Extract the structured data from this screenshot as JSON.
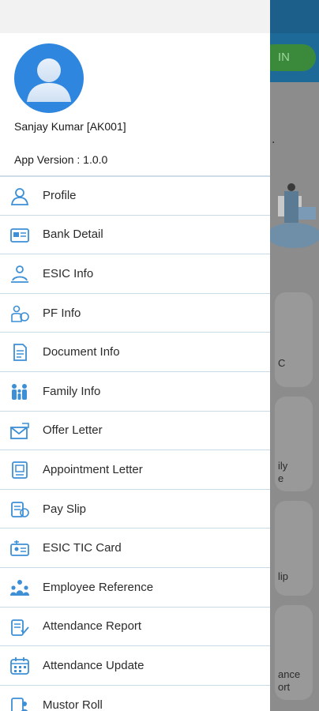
{
  "background_app": {
    "in_button_label": "IN",
    "partial_texts": [
      ".",
      "C",
      "ily",
      "e",
      "lip",
      "ance",
      "ort"
    ]
  },
  "drawer": {
    "user_name": "Sanjay Kumar [AK001]",
    "app_version": "App Version : 1.0.0",
    "menu_items": [
      {
        "label": "Profile",
        "icon": "profile-icon"
      },
      {
        "label": "Bank Detail",
        "icon": "bank-card-icon"
      },
      {
        "label": "ESIC Info",
        "icon": "esic-info-icon"
      },
      {
        "label": "PF Info",
        "icon": "pf-info-icon"
      },
      {
        "label": "Document Info",
        "icon": "document-icon"
      },
      {
        "label": "Family Info",
        "icon": "family-icon"
      },
      {
        "label": "Offer Letter",
        "icon": "offer-letter-icon"
      },
      {
        "label": "Appointment Letter",
        "icon": "appointment-letter-icon"
      },
      {
        "label": "Pay Slip",
        "icon": "pay-slip-icon"
      },
      {
        "label": "ESIC TIC Card",
        "icon": "tic-card-icon"
      },
      {
        "label": "Employee Reference",
        "icon": "employee-reference-icon"
      },
      {
        "label": "Attendance Report",
        "icon": "attendance-report-icon"
      },
      {
        "label": "Attendance Update",
        "icon": "calendar-icon"
      },
      {
        "label": "Mustor Roll",
        "icon": "muster-roll-icon"
      }
    ]
  },
  "colors": {
    "accent": "#2e86de",
    "icon_blue": "#3d8fd6",
    "divider": "#c9dbe7"
  }
}
